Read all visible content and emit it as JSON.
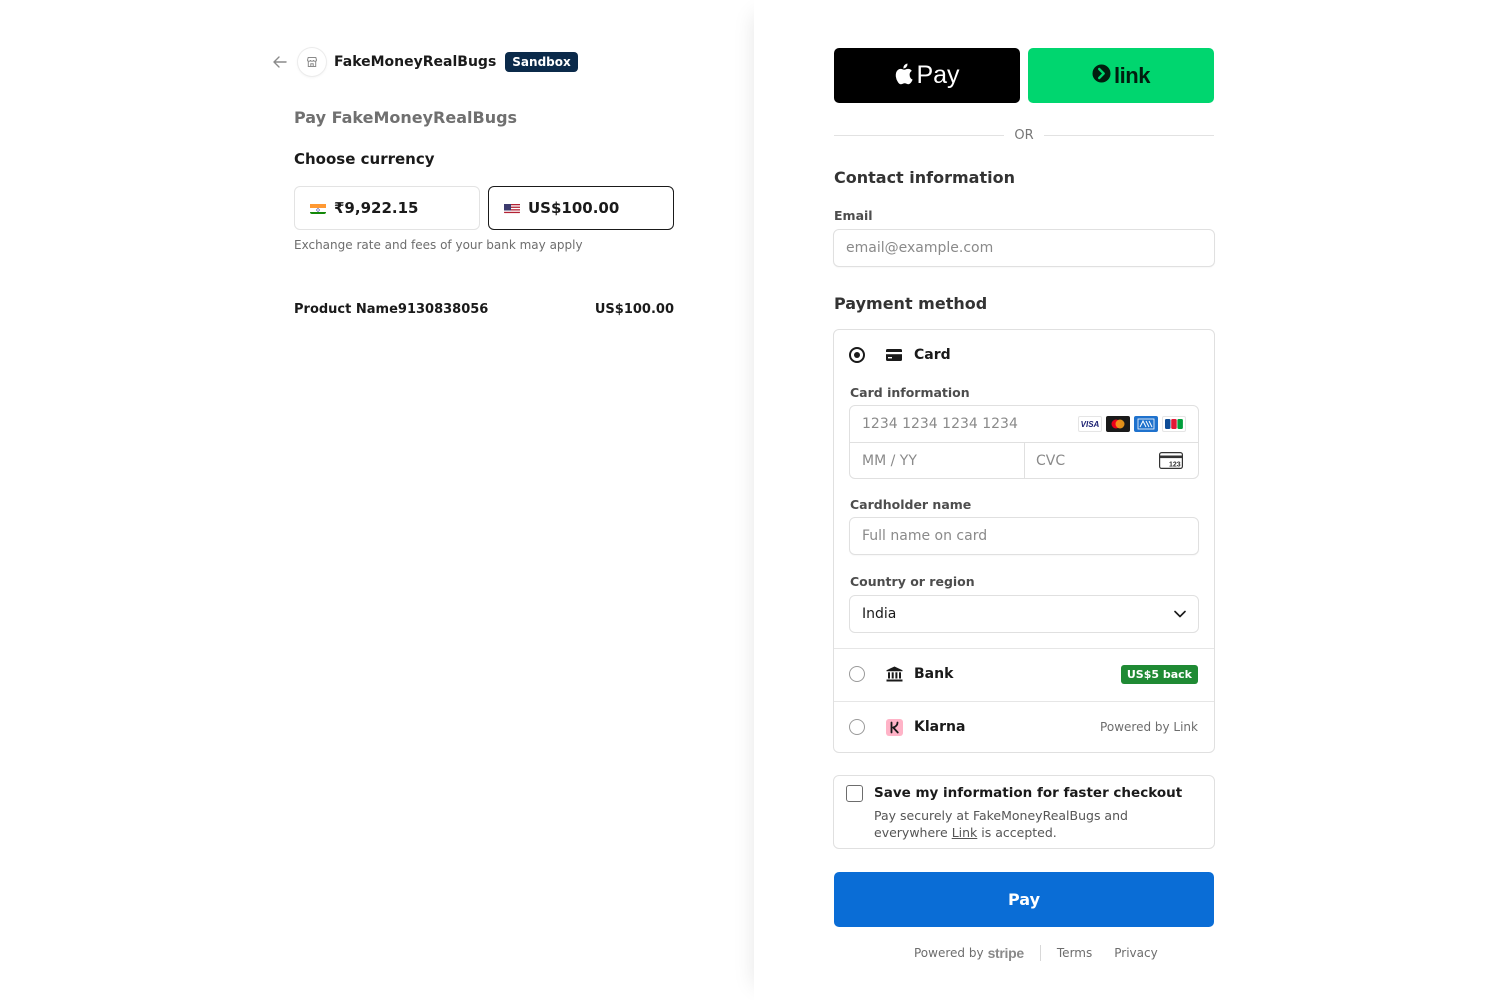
{
  "header": {
    "merchant_name": "FakeMoneyRealBugs",
    "badge": "Sandbox"
  },
  "summary": {
    "pay_title": "Pay FakeMoneyRealBugs",
    "choose_currency": "Choose currency",
    "currency_options": [
      {
        "amount": "₹9,922.15",
        "flag": "india-flag",
        "selected": false
      },
      {
        "amount": "US$100.00",
        "flag": "us-flag",
        "selected": true
      }
    ],
    "fees_note": "Exchange rate and fees of your bank may apply",
    "product_name": "Product Name9130838056",
    "product_price": "US$100.00"
  },
  "wallets": {
    "apple_pay_label": "Pay",
    "link_label": "link"
  },
  "divider_text": "OR",
  "contact": {
    "heading": "Contact information",
    "email_label": "Email",
    "email_placeholder": "email@example.com"
  },
  "payment": {
    "heading": "Payment method",
    "card_label": "Card",
    "card_info_label": "Card information",
    "card_number_placeholder": "1234 1234 1234 1234",
    "expiry_placeholder": "MM / YY",
    "cvc_placeholder": "CVC",
    "card_brands": [
      "VISA",
      "mastercard",
      "amex",
      "jcb"
    ],
    "cardholder_label": "Cardholder name",
    "cardholder_placeholder": "Full name on card",
    "country_label": "Country or region",
    "country_value": "India",
    "bank_label": "Bank",
    "bank_badge": "US$5 back",
    "klarna_label": "Klarna",
    "klarna_note": "Powered by Link",
    "selected_method": "card"
  },
  "save_info": {
    "title": "Save my information for faster checkout",
    "desc_prefix": "Pay securely at FakeMoneyRealBugs and everywhere ",
    "desc_link": "Link",
    "desc_suffix": " is accepted."
  },
  "pay_button": "Pay",
  "footer": {
    "powered_by": "Powered by",
    "stripe": "stripe",
    "terms": "Terms",
    "privacy": "Privacy"
  },
  "colors": {
    "pay_button": "#0a6dd6",
    "link_green": "#00d66f",
    "cashback_badge": "#1f8a34",
    "sandbox_badge": "#0b2a4a"
  }
}
